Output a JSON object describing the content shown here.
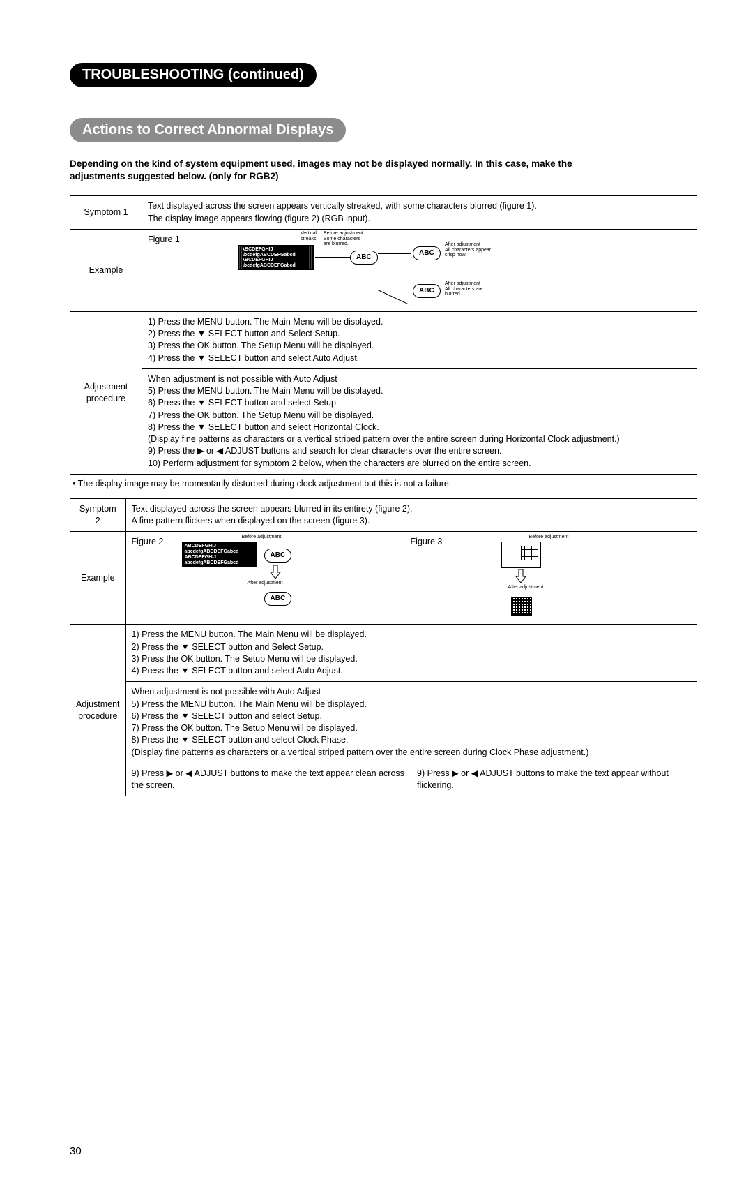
{
  "pill1": "TROUBLESHOOTING (continued)",
  "pill2": "Actions to Correct Abnormal Displays",
  "intro1": "Depending on the kind of system equipment used, images may not be displayed normally.  In this case, make the",
  "intro2": "adjustments suggested below. (only for RGB2)",
  "t1": {
    "symptom_label": "Symptom 1",
    "symptom_text1": "Text displayed across the screen appears vertically streaked, with some characters blurred (figure 1).",
    "symptom_text2": "The display image appears flowing (figure 2) (RGB input).",
    "example_label": "Example",
    "fig1_label": "Figure 1",
    "fig1_imgline1": "ABCDEFGHIJ",
    "fig1_imgline2": "abcdefgABCDEFGabcd",
    "vertical_streaks": "Vertical\nstreaks",
    "before_adj1": "Before adjustment\nSome characters\nare blurred.",
    "after_adj_ok": "After adjustment\nAll characters appear\ncrisp now.",
    "after_adj_bad": "After adjustment\nAll characters are\nblurred.",
    "abc": "ABC",
    "adj_label1": "Adjustment",
    "adj_label2": "procedure",
    "steps_a": "1) Press the MENU button. The Main Menu will be displayed.\n2) Press the ▼ SELECT button and Select Setup.\n3) Press the OK button. The Setup Menu will be displayed.\n4) Press the ▼ SELECT button and select Auto Adjust.",
    "steps_b": "When adjustment is not possible with Auto Adjust\n5) Press the MENU button. The Main Menu will be displayed.\n6) Press the ▼ SELECT button and select Setup.\n7) Press the OK button. The Setup Menu will be displayed.\n8) Press the ▼ SELECT button and select Horizontal Clock.\n(Display fine patterns as characters or a vertical striped pattern over the entire screen during Horizontal Clock adjustment.)\n9) Press the ▶ or ◀ ADJUST buttons and search for clear characters over the entire screen.\n10) Perform adjustment for symptom 2 below, when the characters are blurred on the entire screen."
  },
  "note": "• The display image may be momentarily disturbed during clock adjustment but this is not a failure.",
  "t2": {
    "symptom_label": "Symptom 2",
    "symptom_text1": "Text displayed across the screen appears blurred in its entirety (figure 2).",
    "symptom_text2": "A fine pattern flickers when displayed on the screen (figure 3).",
    "example_label": "Example",
    "fig2_label": "Figure 2",
    "fig3_label": "Figure 3",
    "before_adj": "Before adjustment",
    "after_adj": "After adjustment",
    "abc": "ABC",
    "adj_label1": "Adjustment",
    "adj_label2": "procedure",
    "steps_a": "1) Press the MENU button. The Main Menu will be displayed.\n2) Press the ▼ SELECT button and Select Setup.\n3) Press the OK button. The Setup Menu will be displayed.\n4) Press the ▼ SELECT button and select Auto Adjust.",
    "steps_b": "When adjustment is not possible with Auto Adjust\n5) Press the MENU button. The Main Menu will be displayed.\n6) Press the ▼ SELECT button and select Setup.\n7) Press the OK button. The Setup Menu will be displayed.\n8) Press the ▼ SELECT button and select Clock Phase.\n(Display fine patterns as characters or a vertical striped pattern over the entire screen during Clock Phase adjustment.)",
    "step9_left": "9) Press ▶ or ◀ ADJUST buttons to make the text appear clean across the screen.",
    "step9_right": "9) Press ▶ or ◀ ADJUST buttons to make the text appear without flickering."
  },
  "page_number": "30"
}
